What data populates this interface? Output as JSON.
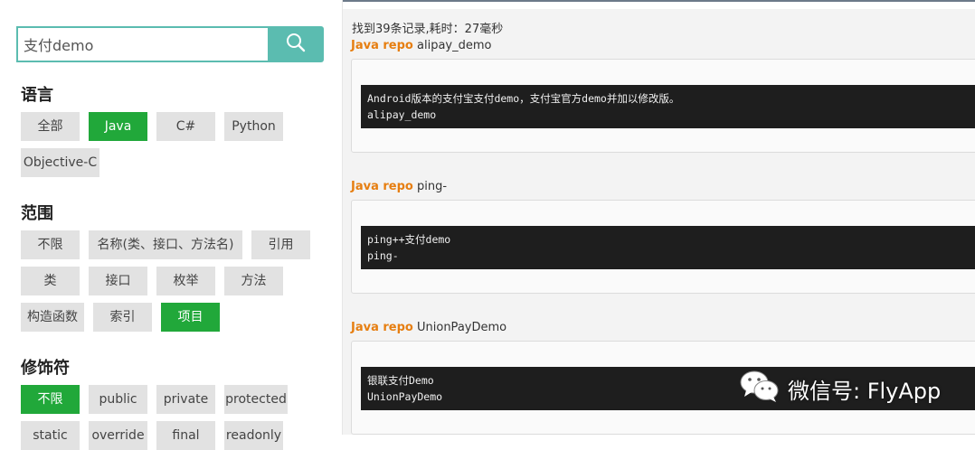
{
  "search": {
    "value": "支付demo",
    "button_icon": "search-icon"
  },
  "filters": {
    "language": {
      "title": "语言",
      "options": [
        "全部",
        "Java",
        "C#",
        "Python",
        "Objective-C"
      ],
      "selected": "Java"
    },
    "scope": {
      "title": "范围",
      "options": [
        "不限",
        "名称(类、接口、方法名)",
        "引用",
        "类",
        "接口",
        "枚举",
        "方法",
        "构造函数",
        "索引",
        "项目"
      ],
      "selected": "项目"
    },
    "modifier": {
      "title": "修饰符",
      "options": [
        "不限",
        "public",
        "private",
        "protected",
        "static",
        "override",
        "final",
        "readonly"
      ],
      "selected": "不限"
    }
  },
  "results": {
    "summary": "找到39条记录,耗时：27毫秒",
    "items": [
      {
        "type": "Java repo",
        "name": "alipay_demo",
        "code_line1": "Android版本的支付宝支付demo，支付宝官方demo并加以修改版。",
        "code_line2": "alipay_demo"
      },
      {
        "type": "Java repo",
        "name": "ping-",
        "code_line1": "ping++支付demo",
        "code_line2": "ping-"
      },
      {
        "type": "Java repo",
        "name": "UnionPayDemo",
        "code_line1": "银联支付Demo",
        "code_line2": "UnionPayDemo"
      }
    ]
  },
  "watermark": {
    "text": "微信号: FlyApp",
    "icon": "wechat-icon"
  },
  "colors": {
    "accent_teal": "#5bbcb0",
    "active_green": "#21a83a",
    "repo_orange": "#e67e10",
    "chip_gray": "#e2e2e2",
    "code_bg": "#1e1e1e"
  }
}
